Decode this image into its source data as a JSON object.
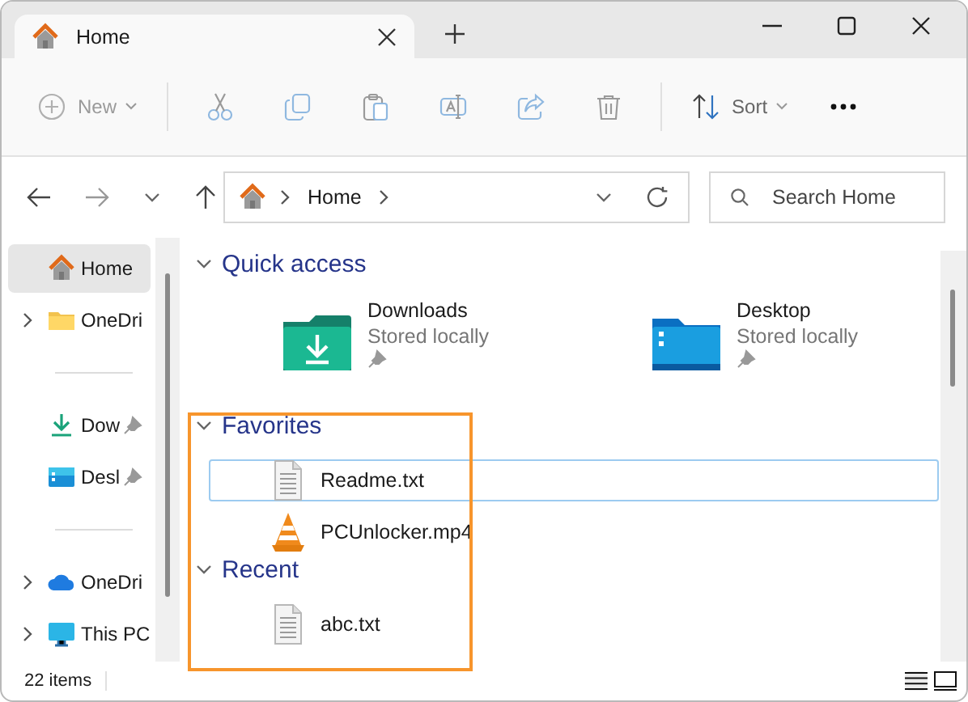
{
  "window": {
    "tab": {
      "title": "Home",
      "selected": true
    }
  },
  "toolbar": [
    {
      "kind": "new",
      "label": "New",
      "disabled": true
    },
    {
      "kind": "cut",
      "disabled": true
    },
    {
      "kind": "copy",
      "disabled": true
    },
    {
      "kind": "paste",
      "disabled": true
    },
    {
      "kind": "rename",
      "disabled": true
    },
    {
      "kind": "share",
      "disabled": true
    },
    {
      "kind": "delete",
      "disabled": true
    },
    {
      "kind": "sort",
      "label": "Sort"
    },
    {
      "kind": "more"
    }
  ],
  "address": {
    "path": "Home",
    "search_placeholder": "Search Home"
  },
  "sidebar": {
    "groups": [
      [
        {
          "kind": "home",
          "label": "Home",
          "selected": true,
          "expandable": false,
          "pinned": false
        },
        {
          "kind": "folder",
          "label": "OneDri",
          "selected": false,
          "expandable": true,
          "pinned": false
        }
      ],
      [
        {
          "kind": "download",
          "label": "Dow",
          "selected": false,
          "expandable": false,
          "pinned": true
        },
        {
          "kind": "desktop",
          "label": "Desl",
          "selected": false,
          "expandable": false,
          "pinned": true
        }
      ],
      [
        {
          "kind": "cloud",
          "label": "OneDri",
          "selected": false,
          "expandable": true,
          "pinned": false
        },
        {
          "kind": "pc",
          "label": "This PC",
          "selected": false,
          "expandable": true,
          "pinned": false
        }
      ]
    ]
  },
  "sections": [
    {
      "title": "Quick access",
      "expanded": true,
      "kind": "tiles",
      "items": [
        {
          "kind": "downloads",
          "name": "Downloads",
          "status": "Stored locally",
          "pinned": true
        },
        {
          "kind": "desktop",
          "name": "Desktop",
          "status": "Stored locally",
          "pinned": true
        }
      ]
    },
    {
      "title": "Favorites",
      "expanded": true,
      "kind": "list",
      "items": [
        {
          "kind": "text",
          "name": "Readme.txt",
          "selected": true
        },
        {
          "kind": "video",
          "name": "PCUnlocker.mp4",
          "selected": false
        }
      ]
    },
    {
      "title": "Recent",
      "expanded": true,
      "kind": "list",
      "items": [
        {
          "kind": "text",
          "name": "abc.txt",
          "selected": false
        }
      ]
    }
  ],
  "status_bar": {
    "count": "22 items"
  }
}
